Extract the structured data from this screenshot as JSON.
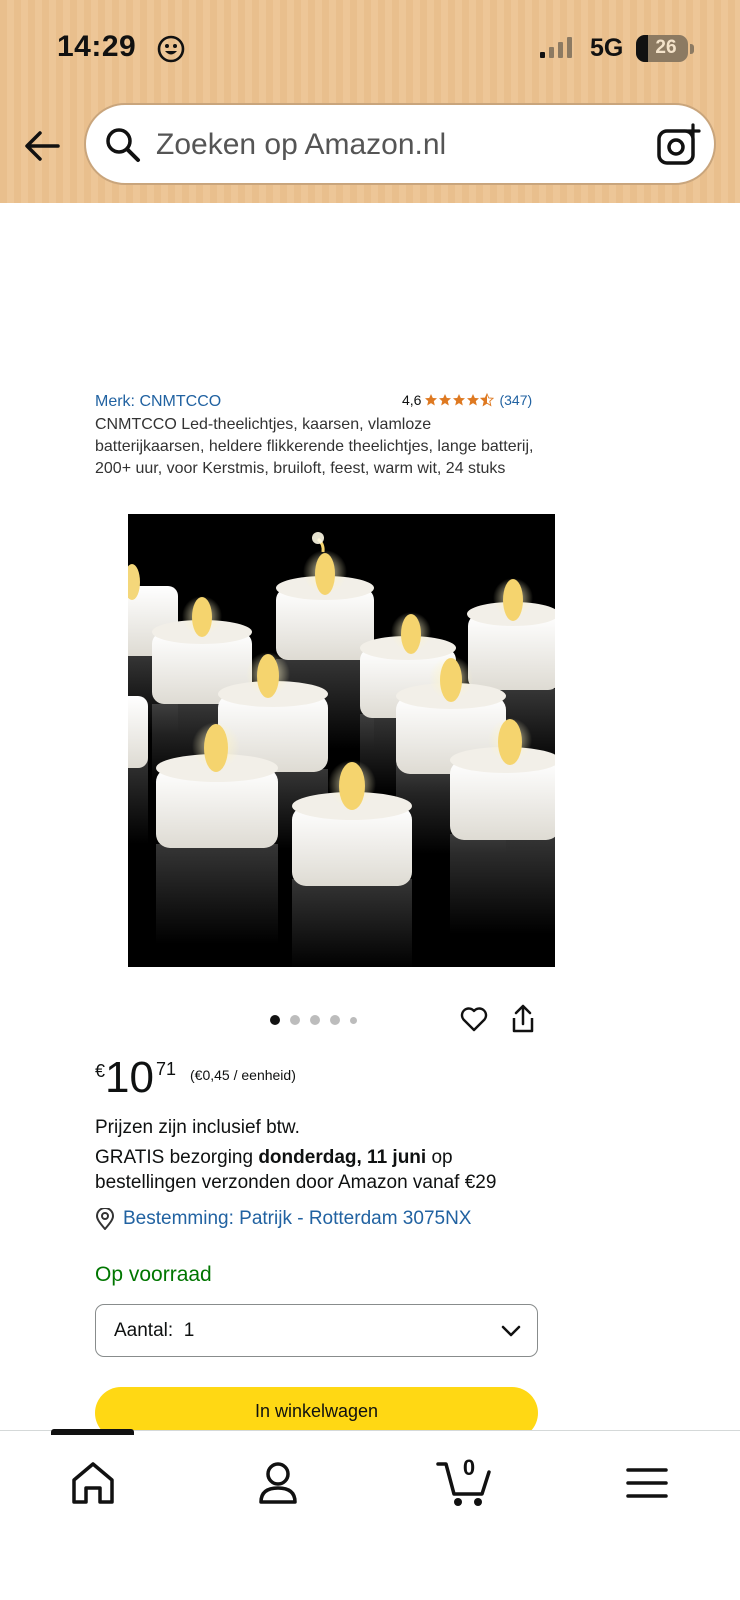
{
  "status_bar": {
    "time": "14:29",
    "network": "5G",
    "battery": "26",
    "smiley_icon": "smiley-face-icon",
    "signal_icon": "cellular-signal-icon"
  },
  "header": {
    "back_icon": "arrow-left-icon",
    "search_placeholder": "Zoeken op Amazon.nl",
    "search_icon": "magnifier-icon",
    "camera_icon": "camera-lens-icon"
  },
  "product": {
    "brand": "Merk: CNMTCCO",
    "rating": "4,6",
    "rating_stars": 4.5,
    "rating_count": "(347)",
    "title": "CNMTCCO Led-theelichtjes, kaarsen, vlamloze batterijkaarsen, heldere flikkerende theelichtjes, lange batterij, 200+ uur, voor Kerstmis, bruiloft, feest, warm wit, 24 stuks",
    "image_count": 5,
    "active_image": 1
  },
  "pricing": {
    "symbol": "€",
    "whole": "10",
    "fraction": "71",
    "unit_price": "(€0,45 / eenheid)",
    "vat_note": "Prijzen zijn inclusief btw.",
    "delivery_prefix": "GRATIS bezorging ",
    "delivery_date": "donderdag, 11 juni",
    "delivery_suffix": " op bestellingen verzonden door Amazon vanaf €29",
    "destination": "Bestemming: Patrijk - Rotterdam 3075NX"
  },
  "availability": {
    "stock": "Op voorraad",
    "quantity_label": "Aantal:",
    "quantity_value": "1"
  },
  "actions": {
    "add_to_cart": "In winkelwagen"
  },
  "bottom_nav": {
    "items": [
      "home-icon",
      "account-icon",
      "cart-icon",
      "menu-icon"
    ],
    "cart_count": "0"
  },
  "colors": {
    "header_bg": "#edc697",
    "link": "#2162a1",
    "stock": "#007600",
    "star": "#de7921",
    "cart_button": "#ffd814"
  }
}
